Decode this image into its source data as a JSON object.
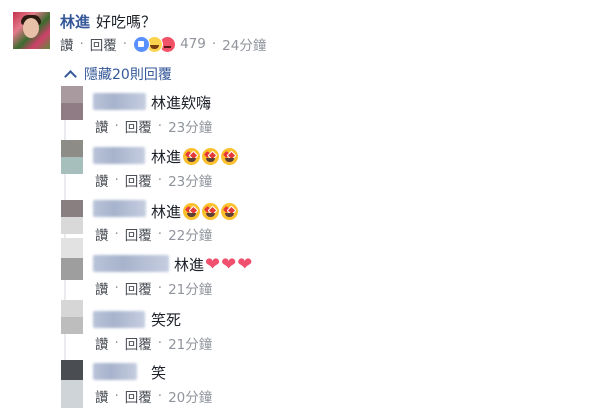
{
  "comment": {
    "author": "林進",
    "text": "好吃嗎？",
    "like_label": "讚",
    "reply_label": "回覆",
    "reaction_count": "479",
    "time": "24分鐘"
  },
  "toggle": {
    "label": "隱藏20則回覆"
  },
  "replies": [
    {
      "name_text": "",
      "text": "林進欸嗨",
      "like_label": "讚",
      "reply_label": "回覆",
      "time": "23分鐘"
    },
    {
      "name_text": "",
      "text": "林進",
      "like_label": "讚",
      "reply_label": "回覆",
      "time": "23分鐘"
    },
    {
      "name_text": "",
      "text": "林進",
      "like_label": "讚",
      "reply_label": "回覆",
      "time": "22分鐘"
    },
    {
      "name_text": "",
      "text": "林進",
      "like_label": "讚",
      "reply_label": "回覆",
      "time": "21分鐘"
    },
    {
      "name_text": "",
      "text": "笑死",
      "like_label": "讚",
      "reply_label": "回覆",
      "time": "21分鐘"
    },
    {
      "name_text": "",
      "text": "笑",
      "like_label": "讚",
      "reply_label": "回覆",
      "time": "20分鐘"
    }
  ],
  "icons": {
    "reactions": [
      "like-icon",
      "haha-icon",
      "angry-icon"
    ],
    "reply_emojis": [
      "heart-eyes-emoji",
      "heart-eyes-emoji",
      "heart-eyes-emoji"
    ],
    "reply_hearts": [
      "red-heart-emoji",
      "red-heart-emoji",
      "red-heart-emoji"
    ]
  },
  "colors": {
    "link": "#365899",
    "text": "#1d2129",
    "meta": "#90949c",
    "heart": "#f0506e"
  }
}
